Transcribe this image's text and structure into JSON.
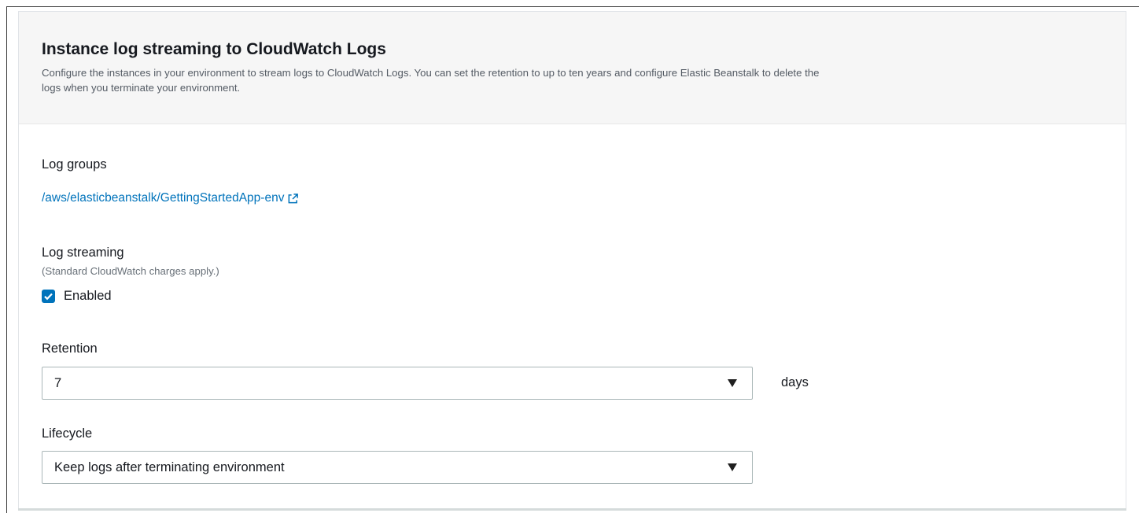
{
  "panel": {
    "title": "Instance log streaming to CloudWatch Logs",
    "description_line1": "Configure the instances in your environment to stream logs to CloudWatch Logs. You can set the retention to up to ten years and configure Elastic Beanstalk to delete the",
    "description_line2": "logs when you terminate your environment."
  },
  "log_groups": {
    "label": "Log groups",
    "link_text": "/aws/elasticbeanstalk/GettingStartedApp-env",
    "link_icon": "external-link-icon"
  },
  "log_streaming": {
    "label": "Log streaming",
    "note": "(Standard CloudWatch charges apply.)",
    "checkbox_label": "Enabled",
    "checked": true
  },
  "retention": {
    "label": "Retention",
    "value": "7",
    "unit": "days"
  },
  "lifecycle": {
    "label": "Lifecycle",
    "value": "Keep logs after terminating environment"
  },
  "colors": {
    "accent": "#0073bb",
    "header_bg": "#f6f6f6",
    "text": "#16191f"
  }
}
